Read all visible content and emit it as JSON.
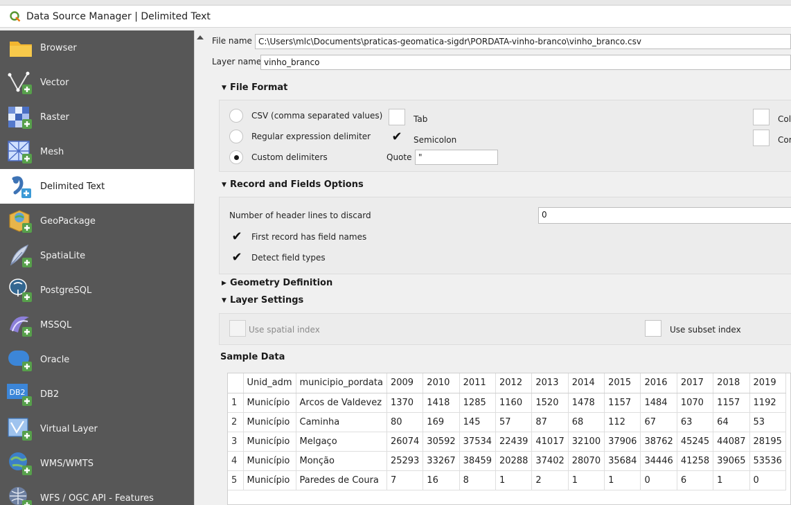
{
  "window": {
    "title": "Data Source Manager | Delimited Text"
  },
  "sidebar": {
    "items": [
      {
        "label": "Browser",
        "icon": "folder-icon"
      },
      {
        "label": "Vector",
        "icon": "vector-layer-icon"
      },
      {
        "label": "Raster",
        "icon": "raster-layer-icon"
      },
      {
        "label": "Mesh",
        "icon": "mesh-layer-icon"
      },
      {
        "label": "Delimited Text",
        "icon": "delimited-text-icon",
        "active": true
      },
      {
        "label": "GeoPackage",
        "icon": "geopackage-icon"
      },
      {
        "label": "SpatiaLite",
        "icon": "spatialite-icon"
      },
      {
        "label": "PostgreSQL",
        "icon": "postgresql-icon"
      },
      {
        "label": "MSSQL",
        "icon": "mssql-icon"
      },
      {
        "label": "Oracle",
        "icon": "oracle-icon"
      },
      {
        "label": "DB2",
        "icon": "db2-icon"
      },
      {
        "label": "Virtual Layer",
        "icon": "virtual-layer-icon"
      },
      {
        "label": "WMS/WMTS",
        "icon": "wms-icon"
      },
      {
        "label": "WFS / OGC API - Features",
        "icon": "wfs-icon"
      }
    ]
  },
  "file": {
    "file_name_label": "File name",
    "file_name_value": "C:\\Users\\mlc\\Documents\\praticas-geomatica-sigdr\\PORDATA-vinho-branco\\vinho_branco.csv",
    "layer_name_label": "Layer name",
    "layer_name_value": "vinho_branco"
  },
  "file_format": {
    "heading": "File Format",
    "radio_csv": "CSV (comma separated values)",
    "radio_regex": "Regular expression delimiter",
    "radio_custom": "Custom delimiters",
    "tab_label": "Tab",
    "semicolon_label": "Semicolon",
    "quote_label": "Quote",
    "quote_value": "\"",
    "colon_label": "Colo",
    "comma_label": "Com"
  },
  "record_options": {
    "heading": "Record and Fields Options",
    "header_lines_label": "Number of header lines to discard",
    "header_lines_value": "0",
    "first_record_label": "First record has field names",
    "detect_types_label": "Detect field types"
  },
  "geometry": {
    "heading": "Geometry Definition"
  },
  "layer_settings": {
    "heading": "Layer Settings",
    "spatial_index_label": "Use spatial index",
    "subset_index_label": "Use subset index"
  },
  "sample": {
    "heading": "Sample Data",
    "columns": [
      "",
      "Unid_adm",
      "municipio_pordata",
      "2009",
      "2010",
      "2011",
      "2012",
      "2013",
      "2014",
      "2015",
      "2016",
      "2017",
      "2018",
      "2019"
    ],
    "rows": [
      [
        "1",
        "Município",
        "Arcos de Valdevez",
        "1370",
        "1418",
        "1285",
        "1160",
        "1520",
        "1478",
        "1157",
        "1484",
        "1070",
        "1157",
        "1192"
      ],
      [
        "2",
        "Município",
        "Caminha",
        "80",
        "169",
        "145",
        "57",
        "87",
        "68",
        "112",
        "67",
        "63",
        "64",
        "53"
      ],
      [
        "3",
        "Município",
        "Melgaço",
        "26074",
        "30592",
        "37534",
        "22439",
        "41017",
        "32100",
        "37906",
        "38762",
        "45245",
        "44087",
        "28195"
      ],
      [
        "4",
        "Município",
        "Monção",
        "25293",
        "33267",
        "38459",
        "20288",
        "37402",
        "28070",
        "35684",
        "34446",
        "41258",
        "39065",
        "53536"
      ],
      [
        "5",
        "Município",
        "Paredes de Coura",
        "7",
        "16",
        "8",
        "1",
        "2",
        "1",
        "1",
        "0",
        "6",
        "1",
        "0"
      ]
    ]
  }
}
